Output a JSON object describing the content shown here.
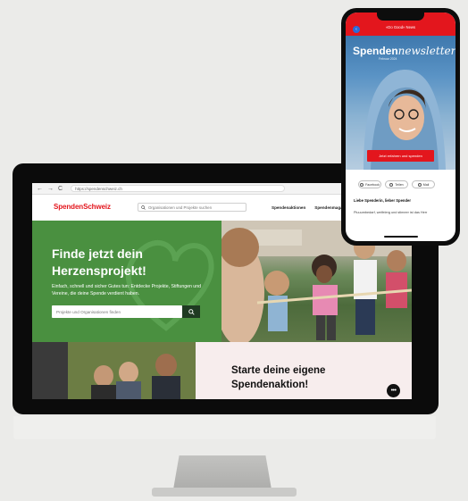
{
  "browser": {
    "url": "https://spendenschweiz.ch",
    "nav_back": "←",
    "nav_forward": "→",
    "nav_reload": "C"
  },
  "site": {
    "logo": "SpendenSchweiz",
    "search_placeholder": "Organisationen und Projekte suchen",
    "nav": [
      "Spendenaktionen",
      "Spendenmagazi"
    ],
    "hero": {
      "title": "Finde jetzt dein Herzensprojekt!",
      "subtitle": "Einfach, schnell und sicher Gutes tun: Entdecke Projekte, Stiftungen und Vereine, die deine Spende verdient haben.",
      "search_placeholder": "Projekte und Organisationen finden",
      "search_icon": "search-icon"
    },
    "cta_title": "Starte deine eigene Spendenaktion!",
    "chat_icon": "chat-bubble-icon",
    "chat_label": "•••"
  },
  "phone": {
    "top_label": "«Do Good» News",
    "newsletter_title_a": "Spenden",
    "newsletter_title_b": "newsletter",
    "newsletter_sub": "Februar 2024",
    "cta_label": "Jetzt erfahren und spenden",
    "pills": [
      "Facebook",
      "Teilen",
      "Mail"
    ],
    "greeting": "Liebe Spenderin, lieber Spender",
    "body_text": "Pluuumbedarf, welfelerg und stimeer ist das Herr"
  },
  "colors": {
    "brand_red": "#e3161d",
    "hero_green": "#4a9040",
    "cta_pink": "#f7eded"
  }
}
